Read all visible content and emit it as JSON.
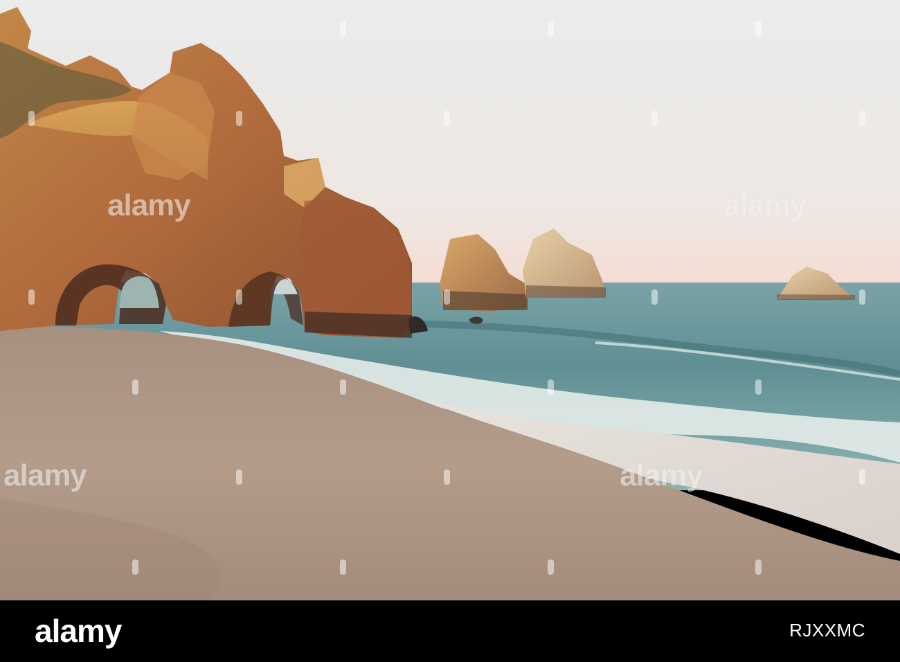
{
  "photo": {
    "alt": "",
    "colors": {
      "sky_top": "#ececea",
      "sky_horizon": "#f3e3da",
      "sea": "#6f9a9c",
      "sand": "#b7a090",
      "cliff": "#b8733d"
    }
  },
  "watermark": {
    "text": "alamy"
  },
  "footer": {
    "logo_text": "alamy",
    "image_id": "RJXXMC"
  }
}
